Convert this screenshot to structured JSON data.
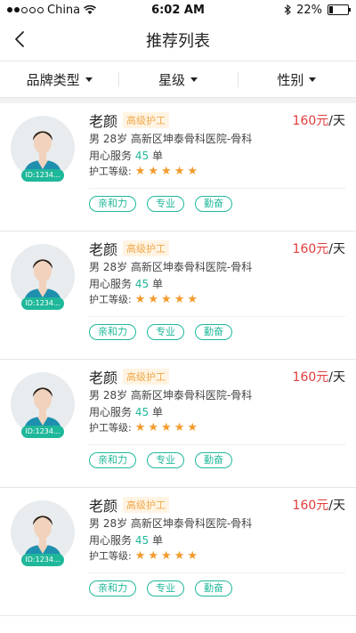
{
  "status": {
    "carrier": "China",
    "time": "6:02 AM",
    "battery": "22%"
  },
  "nav": {
    "title": "推荐列表"
  },
  "filters": [
    "品牌类型",
    "星级",
    "性别"
  ],
  "cards": [
    {
      "id": "ID:1234...",
      "name": "老颜",
      "level": "高级护工",
      "price_num": "160元",
      "price_unit": "/天",
      "details": "男  28岁  高新区坤泰骨科医院-骨科",
      "service_prefix": "用心服务",
      "service_count": "45",
      "service_suffix": "单",
      "grade_label": "护工等级:",
      "stars": 5,
      "tags": [
        "亲和力",
        "专业",
        "勤奋"
      ]
    },
    {
      "id": "ID:1234...",
      "name": "老颜",
      "level": "高级护工",
      "price_num": "160元",
      "price_unit": "/天",
      "details": "男  28岁  高新区坤泰骨科医院-骨科",
      "service_prefix": "用心服务",
      "service_count": "45",
      "service_suffix": "单",
      "grade_label": "护工等级:",
      "stars": 5,
      "tags": [
        "亲和力",
        "专业",
        "勤奋"
      ]
    },
    {
      "id": "ID:1234...",
      "name": "老颜",
      "level": "高级护工",
      "price_num": "160元",
      "price_unit": "/天",
      "details": "男  28岁  高新区坤泰骨科医院-骨科",
      "service_prefix": "用心服务",
      "service_count": "45",
      "service_suffix": "单",
      "grade_label": "护工等级:",
      "stars": 5,
      "tags": [
        "亲和力",
        "专业",
        "勤奋"
      ]
    },
    {
      "id": "ID:1234...",
      "name": "老颜",
      "level": "高级护工",
      "price_num": "160元",
      "price_unit": "/天",
      "details": "男  28岁  高新区坤泰骨科医院-骨科",
      "service_prefix": "用心服务",
      "service_count": "45",
      "service_suffix": "单",
      "grade_label": "护工等级:",
      "stars": 5,
      "tags": [
        "亲和力",
        "专业",
        "勤奋"
      ]
    }
  ],
  "colors": {
    "accent": "#1fb89a",
    "price": "#e23c3c",
    "star": "#f39a2c",
    "level_badge": "#f0a84a"
  }
}
